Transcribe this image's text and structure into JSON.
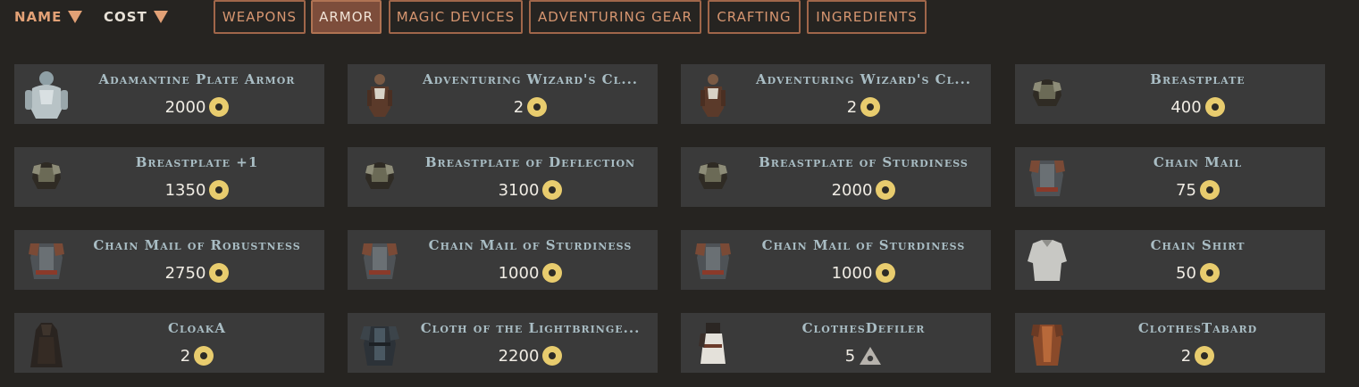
{
  "sort": {
    "name_label": "NAME",
    "cost_label": "COST",
    "icons": [
      "sort-down-triangle-icon",
      "sort-down-triangle-icon"
    ]
  },
  "tabs": [
    {
      "label": "WEAPONS",
      "active": false
    },
    {
      "label": "ARMOR",
      "active": true
    },
    {
      "label": "MAGIC DEVICES",
      "active": false
    },
    {
      "label": "ADVENTURING GEAR",
      "active": false
    },
    {
      "label": "CRAFTING",
      "active": false
    },
    {
      "label": "INGREDIENTS",
      "active": false
    }
  ],
  "colors": {
    "background": "#262421",
    "card": "#3a3a3a",
    "item_name": "#a9bdc4",
    "active_tab": "#7d4d3b",
    "tab_border": "#a0664a",
    "gold_coin": "#e8cc6e"
  },
  "items": [
    {
      "name": "Adamantine Plate Armor",
      "price": "2000",
      "currency": "gold-coin-icon",
      "icon": "plate-armor-icon"
    },
    {
      "name": "Adventuring Wizard's Cl...",
      "price": "2",
      "currency": "gold-coin-icon",
      "icon": "wizard-clothes-icon"
    },
    {
      "name": "Adventuring Wizard's Cl...",
      "price": "2",
      "currency": "gold-coin-icon",
      "icon": "wizard-clothes-icon"
    },
    {
      "name": "Breastplate",
      "price": "400",
      "currency": "gold-coin-icon",
      "icon": "breastplate-icon"
    },
    {
      "name": "Breastplate +1",
      "price": "1350",
      "currency": "gold-coin-icon",
      "icon": "breastplate-icon"
    },
    {
      "name": "Breastplate of Deflection",
      "price": "3100",
      "currency": "gold-coin-icon",
      "icon": "breastplate-icon"
    },
    {
      "name": "Breastplate of Sturdiness",
      "price": "2000",
      "currency": "gold-coin-icon",
      "icon": "breastplate-icon"
    },
    {
      "name": "Chain Mail",
      "price": "75",
      "currency": "gold-coin-icon",
      "icon": "chain-mail-icon"
    },
    {
      "name": "Chain Mail of Robustness",
      "price": "2750",
      "currency": "gold-coin-icon",
      "icon": "chain-mail-icon"
    },
    {
      "name": "Chain Mail of Sturdiness",
      "price": "1000",
      "currency": "gold-coin-icon",
      "icon": "chain-mail-icon"
    },
    {
      "name": "Chain Mail of Sturdiness",
      "price": "1000",
      "currency": "gold-coin-icon",
      "icon": "chain-mail-icon"
    },
    {
      "name": "Chain Shirt",
      "price": "50",
      "currency": "gold-coin-icon",
      "icon": "chain-shirt-icon"
    },
    {
      "name": "CloakA",
      "price": "2",
      "currency": "gold-coin-icon",
      "icon": "cloak-icon"
    },
    {
      "name": "Cloth of the Lightbringe...",
      "price": "2200",
      "currency": "gold-coin-icon",
      "icon": "tunic-icon"
    },
    {
      "name": "ClothesDefiler",
      "price": "5",
      "currency": "influence-triangle-icon",
      "icon": "robe-icon"
    },
    {
      "name": "ClothesTabard",
      "price": "2",
      "currency": "gold-coin-icon",
      "icon": "tabard-icon"
    }
  ]
}
